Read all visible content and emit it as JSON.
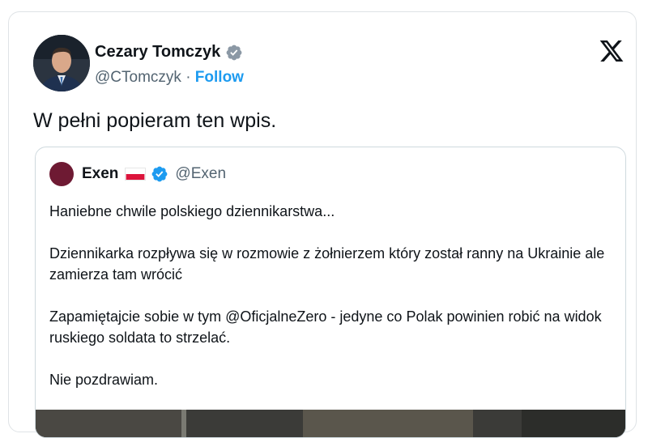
{
  "author": {
    "name": "Cezary Tomczyk",
    "handle": "@CTomczyk",
    "separator": "·",
    "follow_label": "Follow"
  },
  "icons": {
    "verified": "verified-badge-icon",
    "platform": "x-logo-icon",
    "flag": "poland-flag-icon"
  },
  "tweet": {
    "text": "W pełni popieram ten wpis."
  },
  "quoted": {
    "name": "Exen",
    "handle": "@Exen",
    "paragraphs": [
      "Haniebne chwile polskiego dziennikarstwa...",
      "Dziennikarka rozpływa się w rozmowie z żołnierzem który został ranny na Ukrainie ale zamierza tam wrócić",
      "Zapamiętajcie sobie w tym @OficjalneZero - jedyne co Polak powinien robić na widok ruskiego soldata to strzelać.",
      "Nie pozdrawiam."
    ]
  },
  "colors": {
    "verified": "#1d9bf0",
    "follow": "#1d9bf0",
    "secondary_text": "#536471"
  }
}
